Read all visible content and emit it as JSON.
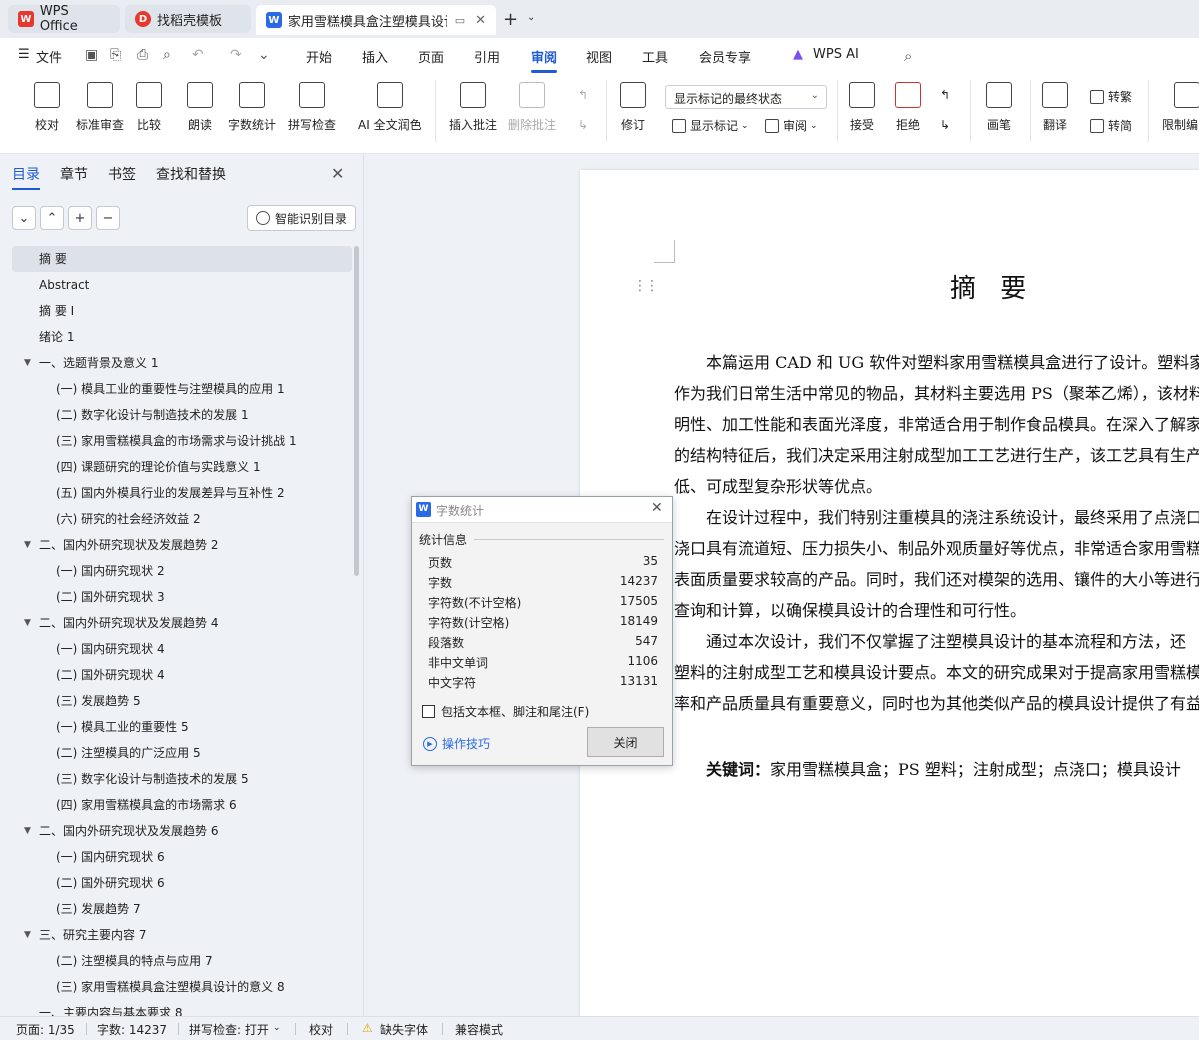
{
  "window": {
    "tabs": [
      {
        "label": "WPS Office",
        "icon": "wps-logo-icon",
        "color": "#e8372c"
      },
      {
        "label": "找稻壳模板",
        "icon": "docer-logo-icon",
        "color": "#e8372c"
      },
      {
        "label": "家用雪糕模具盒注塑模具设计",
        "icon": "word-doc-icon",
        "color": "#2b6ae6"
      }
    ]
  },
  "menu": {
    "file_label": "文件",
    "items": [
      "开始",
      "插入",
      "页面",
      "引用",
      "审阅",
      "视图",
      "工具",
      "会员专享"
    ],
    "active": "审阅",
    "ai_label": "WPS AI"
  },
  "ribbon": {
    "buttons": [
      "校对",
      "标准审查",
      "比较",
      "朗读",
      "字数统计",
      "拼写检查",
      "AI 全文润色",
      "插入批注",
      "删除批注",
      "修订",
      "接受",
      "拒绝",
      "画笔",
      "翻译",
      "限制编"
    ],
    "markup_dropdown": "显示标记的最终状态",
    "show_markup": "显示标记",
    "review_pane": "审阅",
    "trad": "转繁",
    "simp": "转简"
  },
  "nav": {
    "tabs": [
      "目录",
      "章节",
      "书签",
      "查找和替换"
    ],
    "smart_button": "智能识别目录",
    "toc": [
      {
        "label": "摘  要",
        "level": 0,
        "selected": true
      },
      {
        "label": "Abstract",
        "level": 0
      },
      {
        "label": "摘  要 I",
        "level": 0
      },
      {
        "label": "绪论 1",
        "level": 0
      },
      {
        "label": "一、选题背景及意义 1",
        "level": 0,
        "caret": true
      },
      {
        "label": "(一) 模具工业的重要性与注塑模具的应用 1",
        "level": 1
      },
      {
        "label": "(二) 数字化设计与制造技术的发展 1",
        "level": 1
      },
      {
        "label": "(三) 家用雪糕模具盒的市场需求与设计挑战 1",
        "level": 1
      },
      {
        "label": "(四) 课题研究的理论价值与实践意义 1",
        "level": 1
      },
      {
        "label": "(五) 国内外模具行业的发展差异与互补性 2",
        "level": 1
      },
      {
        "label": "(六) 研究的社会经济效益 2",
        "level": 1
      },
      {
        "label": "二、国内外研究现状及发展趋势 2",
        "level": 0,
        "caret": true
      },
      {
        "label": "(一) 国内研究现状 2",
        "level": 1
      },
      {
        "label": "(二) 国外研究现状 3",
        "level": 1
      },
      {
        "label": "二、国内外研究现状及发展趋势 4",
        "level": 0,
        "caret": true
      },
      {
        "label": "(一) 国内研究现状 4",
        "level": 1
      },
      {
        "label": "(二) 国外研究现状 4",
        "level": 1
      },
      {
        "label": "(三) 发展趋势 5",
        "level": 1
      },
      {
        "label": "(一) 模具工业的重要性 5",
        "level": 1
      },
      {
        "label": "(二) 注塑模具的广泛应用 5",
        "level": 1
      },
      {
        "label": "(三) 数字化设计与制造技术的发展 5",
        "level": 1
      },
      {
        "label": "(四) 家用雪糕模具盒的市场需求 6",
        "level": 1
      },
      {
        "label": "二、国内外研究现状及发展趋势 6",
        "level": 0,
        "caret": true
      },
      {
        "label": "(一) 国内研究现状 6",
        "level": 1
      },
      {
        "label": "(二) 国外研究现状 6",
        "level": 1
      },
      {
        "label": "(三) 发展趋势 7",
        "level": 1
      },
      {
        "label": "三、研究主要内容 7",
        "level": 0,
        "caret": true
      },
      {
        "label": "(二) 注塑模具的特点与应用 7",
        "level": 1
      },
      {
        "label": "(三) 家用雪糕模具盒注塑模具设计的意义 8",
        "level": 1
      },
      {
        "label": "一、主要内容与基本要求 8",
        "level": 0
      }
    ]
  },
  "document": {
    "title": "摘  要",
    "paragraphs": [
      [
        "本篇运用 CAD 和 UG 软件对塑料家用雪糕模具盒进行了设计。塑料家",
        "作为我们日常生活中常见的物品，其材料主要选用 PS（聚苯乙烯），该材料",
        "明性、加工性能和表面光泽度，非常适合用于制作食品模具。在深入了解家",
        "的结构特征后，我们决定采用注射成型加工工艺进行生产，该工艺具有生产",
        "低、可成型复杂形状等优点。"
      ],
      [
        "在设计过程中，我们特别注重模具的浇注系统设计，最终采用了点浇口",
        "浇口具有流道短、压力损失小、制品外观质量好等优点，非常适合家用雪糕",
        "表面质量要求较高的产品。同时，我们还对模架的选用、镶件的大小等进行",
        "查询和计算，以确保模具设计的合理性和可行性。"
      ],
      [
        "通过本次设计，我们不仅掌握了注塑模具设计的基本流程和方法，还",
        "塑料的注射成型工艺和模具设计要点。本文的研究成果对于提高家用雪糕模",
        "率和产品质量具有重要意义，同时也为其他类似产品的模具设计提供了有益"
      ]
    ],
    "keywords_label": "关键词：",
    "keywords": "家用雪糕模具盒；PS 塑料；注射成型；点浇口；模具设计"
  },
  "dialog": {
    "title": "字数统计",
    "group": "统计信息",
    "stats": [
      {
        "label": "页数",
        "value": "35"
      },
      {
        "label": "字数",
        "value": "14237"
      },
      {
        "label": "字符数(不计空格)",
        "value": "17505"
      },
      {
        "label": "字符数(计空格)",
        "value": "18149"
      },
      {
        "label": "段落数",
        "value": "547"
      },
      {
        "label": "非中文单词",
        "value": "1106"
      },
      {
        "label": "中文字符",
        "value": "13131"
      }
    ],
    "checkbox": "包括文本框、脚注和尾注(F)",
    "tips": "操作技巧",
    "close": "关闭"
  },
  "status": {
    "page": "页面: 1/35",
    "words": "字数: 14237",
    "spell": "拼写检查: 打开",
    "proof": "校对",
    "font": "缺失字体",
    "compat": "兼容模式"
  }
}
